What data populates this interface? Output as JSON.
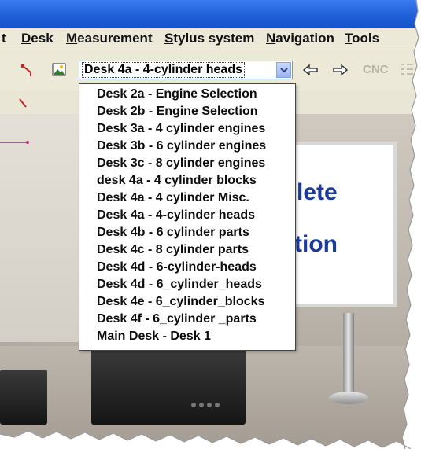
{
  "menubar": {
    "items": [
      {
        "label": "t",
        "underline": ""
      },
      {
        "label": "esk",
        "underline": "D"
      },
      {
        "label": "easurement",
        "underline": "M"
      },
      {
        "label": "tylus system",
        "underline": "S"
      },
      {
        "label": "avigation",
        "underline": "N"
      },
      {
        "label": "ools",
        "underline": "T"
      }
    ]
  },
  "toolbar": {
    "desk_combo": {
      "selected": "Desk 4a - 4-cylinder heads"
    },
    "back_icon": "left-arrow-icon",
    "forward_icon": "right-arrow-icon",
    "cnc_label": "CNC"
  },
  "dropdown": {
    "options": [
      "Desk 2a - Engine Selection",
      "Desk 2b - Engine Selection",
      "Desk 3a - 4 cylinder engines",
      "Desk 3b - 6 cylinder engines",
      "Desk 3c - 8 cylinder engines",
      "desk 4a - 4 cylinder blocks",
      "Desk 4a - 4 cylinder Misc.",
      "Desk 4a - 4-cylinder heads",
      "Desk 4b - 6 cylinder parts",
      "Desk 4c - 8 cylinder parts",
      "Desk 4d - 6-cylinder-heads",
      "Desk 4d - 6_cylinder_heads",
      "Desk 4e - 6_cylinder_blocks",
      "Desk 4f - 6_cylinder _parts",
      "Main Desk - Desk 1"
    ]
  },
  "background_slide": {
    "line1": "lete",
    "line2": "tion"
  },
  "colors": {
    "titlebar": "#1f5fd8",
    "menubar": "#ece9d8",
    "slide_text": "#1b3b9a"
  }
}
